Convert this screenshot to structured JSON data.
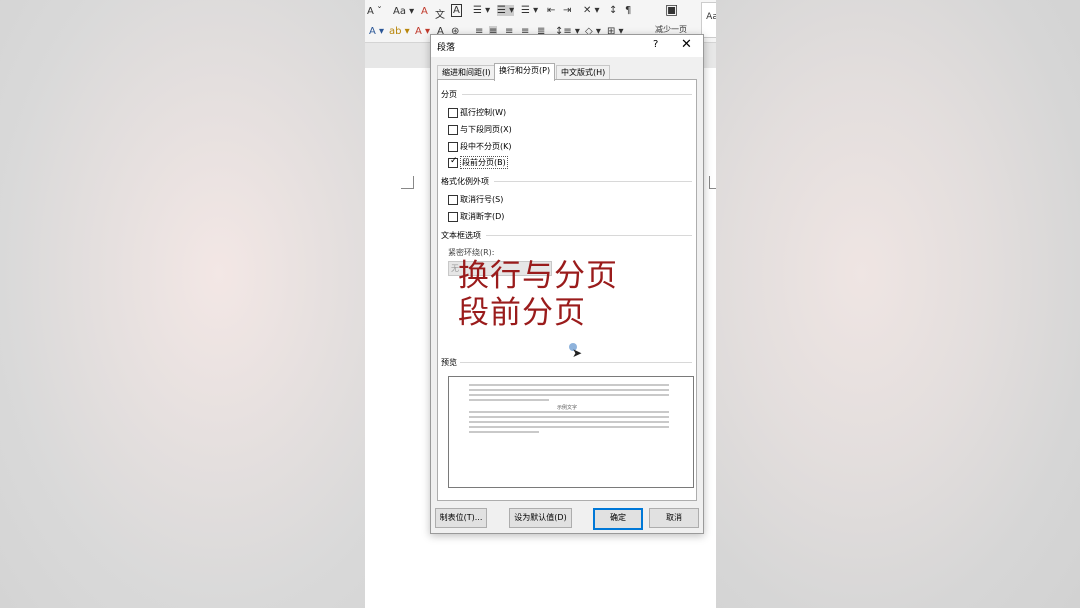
{
  "dialog": {
    "title": "段落",
    "help": "?",
    "close": "✕",
    "tabs": [
      {
        "label": "缩进和间距(I)",
        "active": false
      },
      {
        "label": "换行和分页(P)",
        "active": true
      },
      {
        "label": "中文版式(H)",
        "active": false
      }
    ],
    "pagination": {
      "heading": "分页",
      "items": [
        {
          "label": "孤行控制(W)",
          "checked": false
        },
        {
          "label": "与下段同页(X)",
          "checked": false
        },
        {
          "label": "段中不分页(K)",
          "checked": false
        },
        {
          "label": "段前分页(B)",
          "checked": true
        }
      ]
    },
    "exceptions": {
      "heading": "格式化例外项",
      "items": [
        {
          "label": "取消行号(S)",
          "checked": false
        },
        {
          "label": "取消断字(D)",
          "checked": false
        }
      ]
    },
    "textbox": {
      "heading": "文本框选项",
      "wrap_label": "紧密环绕(R):",
      "wrap_value": "无"
    },
    "preview": {
      "heading": "预览",
      "sample": "示例文字"
    },
    "buttons": {
      "tabs": "制表位(T)...",
      "set_default": "设为默认值(D)",
      "ok": "确定",
      "cancel": "取消"
    }
  },
  "ribbon": {
    "style_preview": "Aa",
    "shrink_page": "减少一页"
  },
  "overlay": {
    "line1": "换行与分页",
    "line2": "段前分页"
  },
  "colors": {
    "overlay_text": "#9a1b1b",
    "accent": "#0078d7"
  }
}
